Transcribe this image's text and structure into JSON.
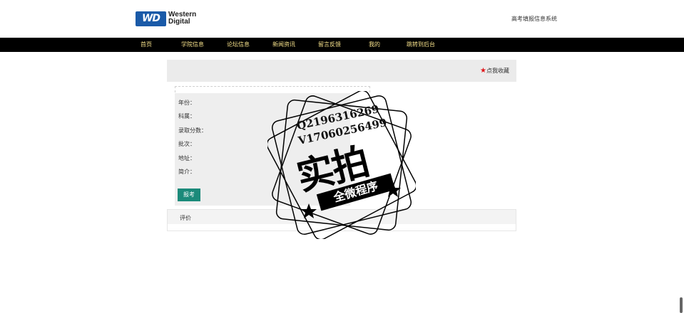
{
  "header": {
    "logo_mark": "WD",
    "logo_word1": "Western",
    "logo_word2": "Digital",
    "site_title": "高考填报信息系统"
  },
  "nav": {
    "items": [
      "首页",
      "学院信息",
      "论坛信息",
      "新闻资讯",
      "留言反馈",
      "我的",
      "跳转到后台"
    ]
  },
  "detail": {
    "collect_label": "点我收藏",
    "fields": [
      "年份：",
      "科属：",
      "录取分数：",
      "批次：",
      "地址：",
      "简介："
    ],
    "apply_label": "报考"
  },
  "review": {
    "tab_label": "评价"
  },
  "watermark": {
    "line1": "Q2196316269",
    "line2": "V17060256499",
    "main": "实拍",
    "sub": "全微程序"
  }
}
